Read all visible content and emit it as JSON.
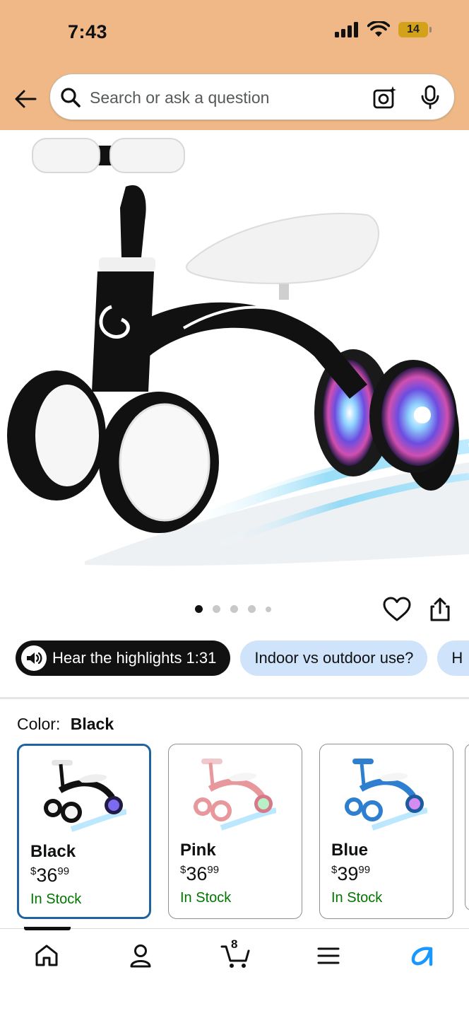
{
  "status_bar": {
    "time": "7:43",
    "battery": "14"
  },
  "search": {
    "placeholder": "Search or ask a question"
  },
  "gallery": {
    "image_count": 5,
    "active_index": 0
  },
  "chips": [
    {
      "label": "Hear the highlights 1:31"
    },
    {
      "label": "Indoor vs outdoor use?"
    },
    {
      "label": "H"
    }
  ],
  "color_selector": {
    "label": "Color:",
    "selected": "Black",
    "options": [
      {
        "name": "Black",
        "price_symbol": "$",
        "price_whole": "36",
        "price_fraction": "99",
        "stock": "In Stock",
        "accent": "#1a1a1a"
      },
      {
        "name": "Pink",
        "price_symbol": "$",
        "price_whole": "36",
        "price_fraction": "99",
        "stock": "In Stock",
        "accent": "#e8989c"
      },
      {
        "name": "Blue",
        "price_symbol": "$",
        "price_whole": "39",
        "price_fraction": "99",
        "stock": "In Stock",
        "accent": "#2f7fd0"
      }
    ]
  },
  "tabbar": {
    "cart_count": "8",
    "items": [
      "home-icon",
      "account-icon",
      "cart-icon",
      "menu-icon",
      "rufus-icon"
    ]
  },
  "colors": {
    "header_bg": "#f0b886",
    "chip_blue": "#cfe3fb",
    "selected_border": "#2162a1",
    "stock_green": "#007600"
  }
}
